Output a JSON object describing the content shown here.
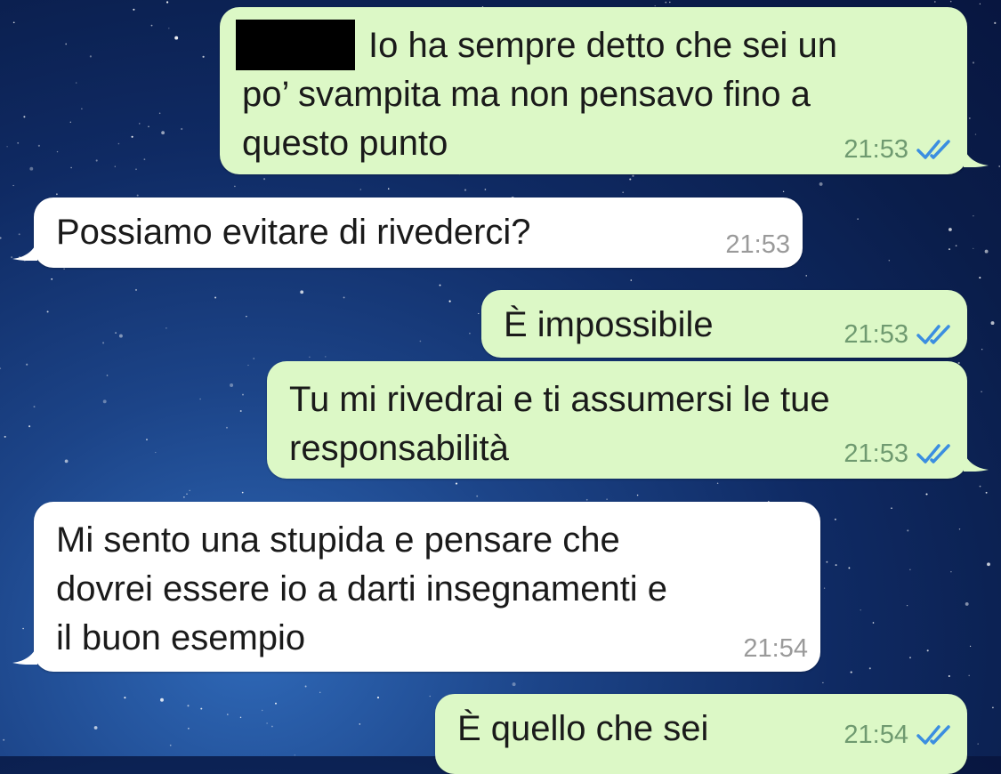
{
  "chat": {
    "background": "starry-night",
    "out_bubble_color": "#dcf8c6",
    "in_bubble_color": "#ffffff",
    "read_tick_color": "#3b8ee0",
    "messages": [
      {
        "direction": "out",
        "text": "Io ha sempre detto che sei un\npo’ svampita ma non pensavo fino a\nquesto punto",
        "time": "21:53",
        "status_icon": "double-check-read-icon",
        "has_redaction": true
      },
      {
        "direction": "in",
        "text": "Possiamo evitare di rivederci?",
        "time": "21:53"
      },
      {
        "direction": "out",
        "text": "È impossibile",
        "time": "21:53",
        "status_icon": "double-check-read-icon"
      },
      {
        "direction": "out",
        "text": "Tu mi rivedrai e ti assumersi le tue\nresponsabilità",
        "time": "21:53",
        "status_icon": "double-check-read-icon"
      },
      {
        "direction": "in",
        "text": "Mi sento una stupida e pensare che\ndovrei essere io a darti insegnamenti e\nil buon esempio",
        "time": "21:54"
      },
      {
        "direction": "out",
        "text": "È quello che sei",
        "time": "21:54",
        "status_icon": "double-check-read-icon"
      }
    ]
  }
}
